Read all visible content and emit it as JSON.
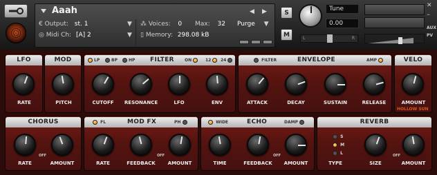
{
  "header": {
    "instrument_name": "Aaah",
    "output_label": "Output:",
    "output_value": "st. 1",
    "voices_label": "Voices:",
    "voices_value": "0",
    "max_label": "Max:",
    "max_value": "32",
    "purge_label": "Purge",
    "midi_label": "Midi Ch:",
    "midi_value": "[A] 2",
    "memory_label": "Memory:",
    "memory_value": "298.08 kB",
    "solo_label": "S",
    "mute_label": "M",
    "tune_label": "Tune",
    "tune_value": "0.00",
    "pan_left": "L",
    "pan_right": "R",
    "aux_label": "AUX",
    "pv_label": "PV"
  },
  "panels": {
    "lfo": {
      "title": "LFO",
      "knobs": [
        {
          "label": "RATE"
        }
      ]
    },
    "mod": {
      "title": "MOD",
      "knobs": [
        {
          "label": "PITCH"
        }
      ]
    },
    "filter": {
      "title": "FILTER",
      "toggles": [
        "LP",
        "BP",
        "HP"
      ],
      "on_label": "ON",
      "slope_12": "12",
      "slope_24": "24",
      "knobs": [
        {
          "label": "CUTOFF"
        },
        {
          "label": "RESONANCE"
        },
        {
          "label": "LFO"
        },
        {
          "label": "ENV"
        }
      ]
    },
    "envelope": {
      "title": "ENVELOPE",
      "filter_label": "FILTER",
      "amp_label": "AMP",
      "knobs": [
        {
          "label": "ATTACK"
        },
        {
          "label": "DECAY"
        },
        {
          "label": "SUSTAIN"
        },
        {
          "label": "RELEASE"
        }
      ]
    },
    "velo": {
      "title": "VELO",
      "knobs": [
        {
          "label": "AMOUNT"
        }
      ],
      "brand": "HOLLOW SUN"
    },
    "chorus": {
      "title": "CHORUS",
      "off_label": "OFF",
      "knobs": [
        {
          "label": "RATE"
        },
        {
          "label": "AMOUNT"
        }
      ]
    },
    "modfx": {
      "title": "MOD FX",
      "fl_label": "FL",
      "ph_label": "PH",
      "off_label": "OFF",
      "knobs": [
        {
          "label": "RATE"
        },
        {
          "label": "FEEDBACK"
        },
        {
          "label": "AMOUNT"
        }
      ]
    },
    "echo": {
      "title": "ECHO",
      "wide_label": "WIDE",
      "damp_label": "DAMP",
      "off_label": "OFF",
      "knobs": [
        {
          "label": "TIME"
        },
        {
          "label": "FEEDBACK"
        },
        {
          "label": "AMOUNT"
        }
      ]
    },
    "reverb": {
      "title": "REVERB",
      "type_options": [
        "S",
        "M",
        "L"
      ],
      "type_selected": "M",
      "off_label": "OFF",
      "knobs": [
        {
          "label": "TYPE"
        },
        {
          "label": "SIZE"
        },
        {
          "label": "AMOUNT"
        }
      ]
    }
  }
}
